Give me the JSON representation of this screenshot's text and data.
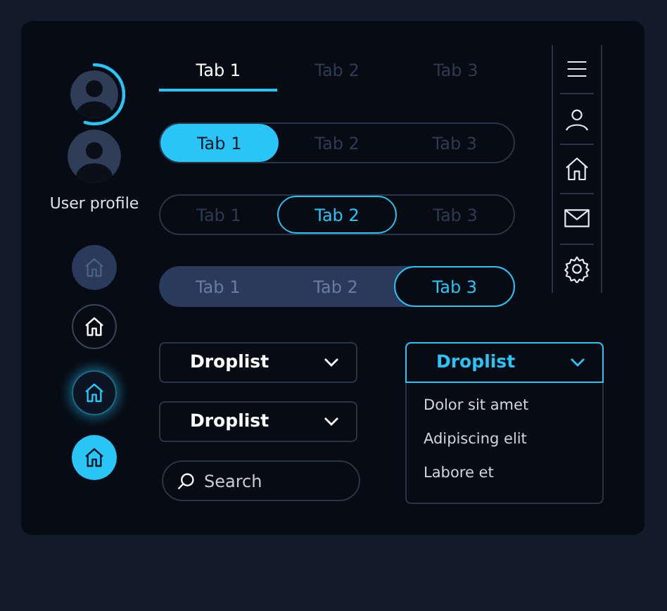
{
  "avatars": [
    {
      "kind": "ring"
    },
    {
      "kind": "plain"
    }
  ],
  "profile_label": "User profile",
  "home_buttons": [
    {
      "kind": "muted"
    },
    {
      "kind": "outline"
    },
    {
      "kind": "glow"
    },
    {
      "kind": "filled"
    }
  ],
  "tab_groups": [
    {
      "kind": "underline",
      "tabs": [
        {
          "label": "Tab 1",
          "selected": true
        },
        {
          "label": "Tab 2",
          "selected": false
        },
        {
          "label": "Tab 3",
          "selected": false
        }
      ]
    },
    {
      "kind": "pill",
      "tabs": [
        {
          "label": "Tab 1",
          "selected": true
        },
        {
          "label": "Tab 2",
          "selected": false
        },
        {
          "label": "Tab 3",
          "selected": false
        }
      ]
    },
    {
      "kind": "outline",
      "tabs": [
        {
          "label": "Tab 1",
          "selected": false
        },
        {
          "label": "Tab 2",
          "selected": true
        },
        {
          "label": "Tab 3",
          "selected": false
        }
      ]
    },
    {
      "kind": "segmented",
      "tabs": [
        {
          "label": "Tab 1",
          "selected": false
        },
        {
          "label": "Tab 2",
          "selected": false
        },
        {
          "label": "Tab 3",
          "selected": true
        }
      ]
    }
  ],
  "droplists": [
    {
      "label": "Droplist",
      "expanded": false
    },
    {
      "label": "Droplist",
      "expanded": false
    }
  ],
  "search": {
    "placeholder": "Search"
  },
  "open_droplist": {
    "label": "Droplist",
    "expanded": true,
    "options": [
      "Dolor sit amet",
      "Adipiscing elit",
      "Labore et"
    ]
  }
}
